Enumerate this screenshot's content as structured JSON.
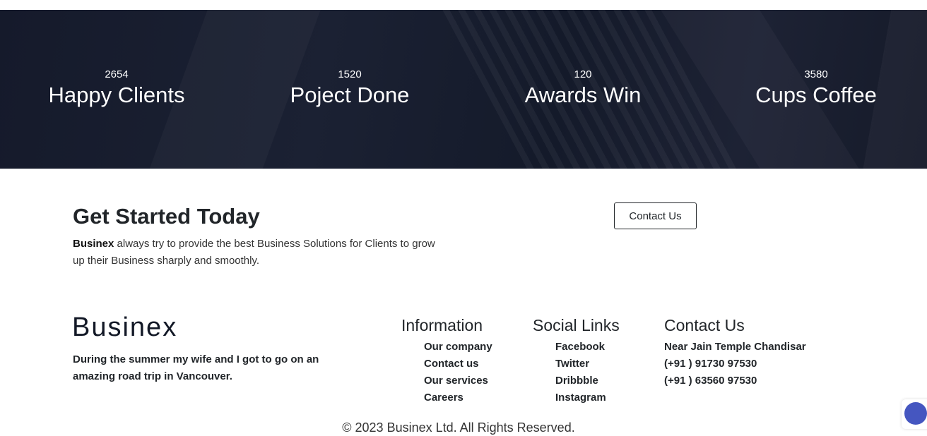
{
  "stats": [
    {
      "number": "2654",
      "label": "Happy Clients"
    },
    {
      "number": "1520",
      "label": "Poject Done"
    },
    {
      "number": "120",
      "label": "Awards Win"
    },
    {
      "number": "3580",
      "label": "Cups Coffee"
    }
  ],
  "cta": {
    "title": "Get Started Today",
    "brand": "Businex",
    "text": " always try to provide the best Business Solutions for Clients to grow up their Business sharply and smoothly.",
    "button_label": "Contact Us"
  },
  "footer": {
    "logo_text": "Businex",
    "about": "During the summer my wife and I got to go on an amazing road trip in Vancouver.",
    "information": {
      "title": "Information",
      "links": [
        "Our company",
        "Contact us",
        "Our services",
        "Careers"
      ]
    },
    "social": {
      "title": "Social Links",
      "links": [
        "Facebook",
        "Twitter",
        "Dribbble",
        "Instagram"
      ]
    },
    "contact": {
      "title": "Contact Us",
      "lines": [
        "Near Jain Temple Chandisar",
        "(+91 ) 91730 97530",
        "(+91 ) 63560 97530"
      ]
    },
    "copyright": "© 2023 Businex Ltd. All Rights Reserved."
  },
  "colors": {
    "stats_bg": "#151a2b",
    "accent_fab": "#4556c0"
  }
}
